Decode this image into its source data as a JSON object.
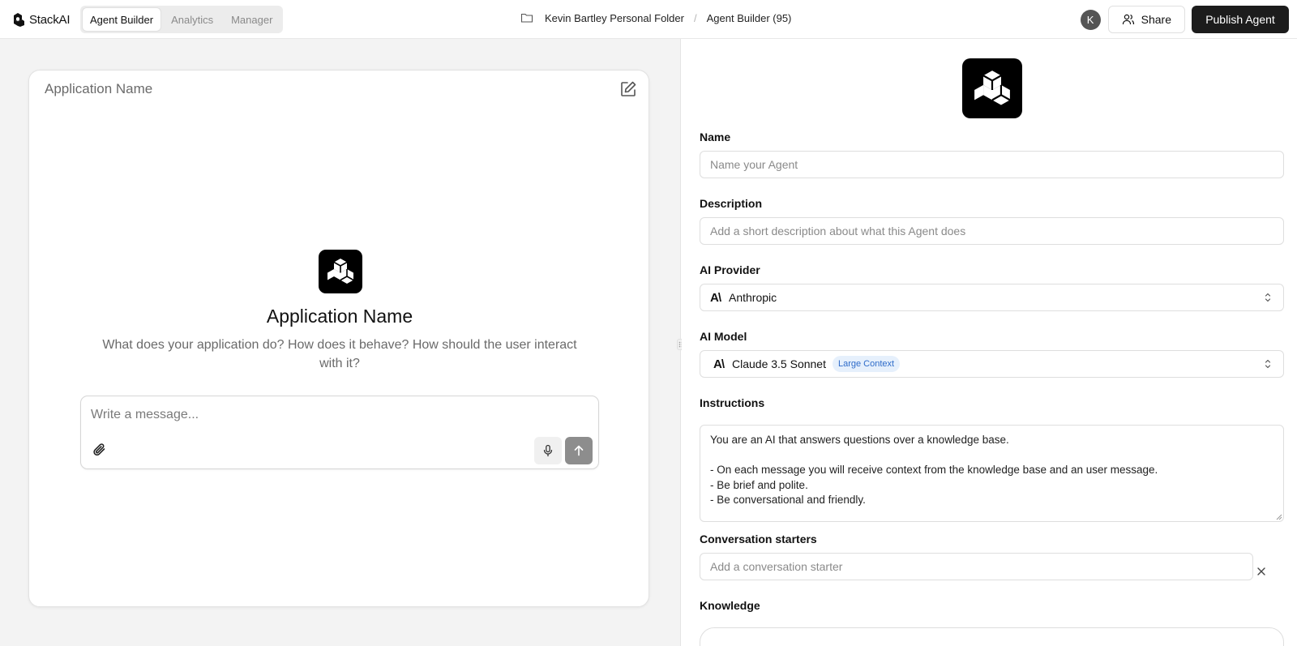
{
  "brand": {
    "name": "StackAI"
  },
  "nav": {
    "tabs": [
      "Agent Builder",
      "Analytics",
      "Manager"
    ],
    "active_index": 0
  },
  "breadcrumb": {
    "folder": "Kevin Bartley Personal Folder",
    "project": "Agent Builder (95)"
  },
  "header": {
    "avatar_initial": "K",
    "share_label": "Share",
    "publish_label": "Publish Agent"
  },
  "preview": {
    "card_title": "Application Name",
    "app_name": "Application Name",
    "app_description": "What does your application do? How does it behave? How should the user interact with it?",
    "message_placeholder": "Write a message..."
  },
  "config": {
    "name": {
      "label": "Name",
      "placeholder": "Name your Agent"
    },
    "description": {
      "label": "Description",
      "placeholder": "Add a short description about what this Agent does"
    },
    "provider": {
      "label": "AI Provider",
      "value": "Anthropic",
      "icon": "A\\"
    },
    "model": {
      "label": "AI Model",
      "value": "Claude 3.5 Sonnet",
      "badge": "Large Context",
      "icon": "A\\"
    },
    "instructions": {
      "label": "Instructions",
      "value": "You are an AI that answers questions over a knowledge base.\n\n- On each message you will receive context from the knowledge base and an user message.\n- Be brief and polite.\n- Be conversational and friendly."
    },
    "starters": {
      "label": "Conversation starters",
      "placeholder": "Add a conversation starter"
    },
    "knowledge": {
      "label": "Knowledge"
    }
  },
  "colors": {
    "primary_button": "#1c1c1c",
    "badge_bg": "#e6f0fc",
    "badge_text": "#2f6cc9",
    "send_button": "#8d8d8d"
  }
}
